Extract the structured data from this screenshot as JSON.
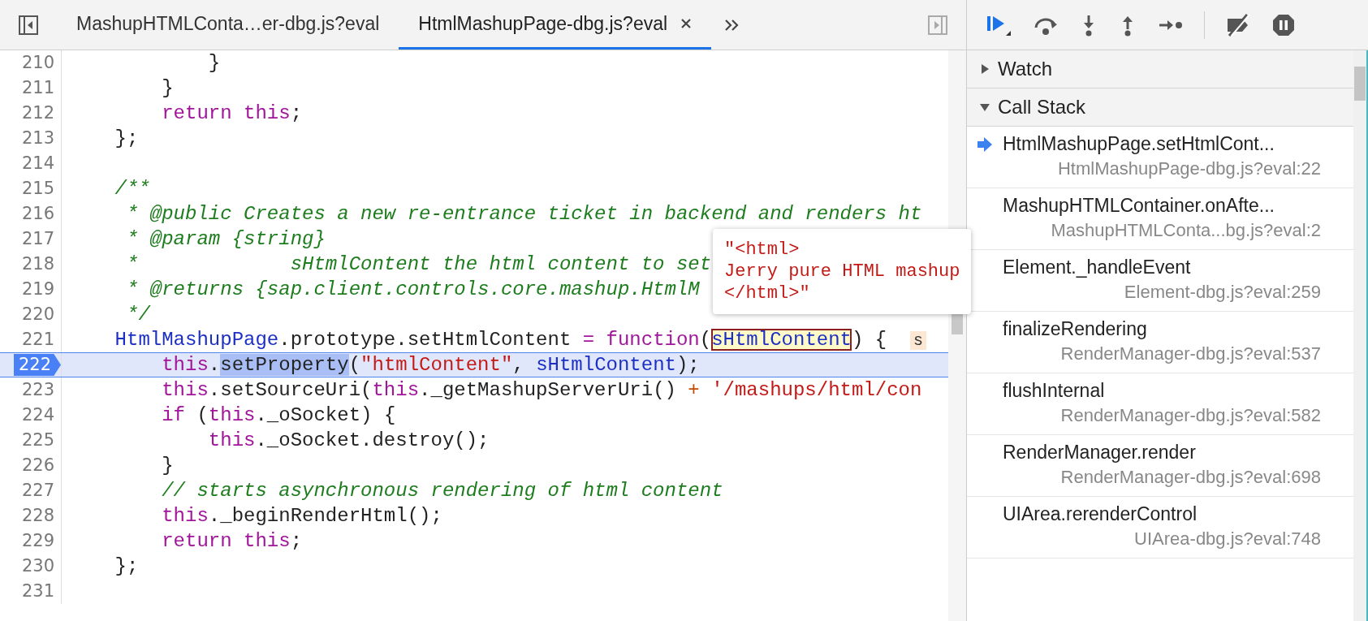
{
  "editor": {
    "tabs": [
      {
        "label": "MashupHTMLConta…er-dbg.js?eval",
        "selected": false,
        "closable": false
      },
      {
        "label": "HtmlMashupPage-dbg.js?eval",
        "selected": true,
        "closable": true
      }
    ],
    "lines": [
      {
        "number": "210",
        "paused": false,
        "tokens": [
          {
            "kind": "plain",
            "text": "            }"
          }
        ]
      },
      {
        "number": "211",
        "paused": false,
        "tokens": [
          {
            "kind": "plain",
            "text": "        }"
          }
        ]
      },
      {
        "number": "212",
        "paused": false,
        "tokens": [
          {
            "kind": "keyword",
            "text": "        return this"
          },
          {
            "kind": "plain",
            "text": ";"
          }
        ]
      },
      {
        "number": "213",
        "paused": false,
        "tokens": [
          {
            "kind": "plain",
            "text": "    };"
          }
        ]
      },
      {
        "number": "214",
        "paused": false
      },
      {
        "number": "215",
        "paused": false,
        "tokens": [
          {
            "kind": "comment",
            "text": "    /**"
          }
        ]
      },
      {
        "number": "216",
        "paused": false,
        "tokens": [
          {
            "kind": "comment",
            "text": "     * @public Creates a new re-entrance ticket in backend and renders ht"
          }
        ]
      },
      {
        "number": "217",
        "paused": false,
        "tokens": [
          {
            "kind": "comment",
            "text": "     * @param {string}"
          }
        ]
      },
      {
        "number": "218",
        "paused": false,
        "tokens": [
          {
            "kind": "comment",
            "text": "     *             sHtmlContent the html content to set"
          }
        ]
      },
      {
        "number": "219",
        "paused": false,
        "tokens": [
          {
            "kind": "comment",
            "text": "     * @returns {sap.client.controls.core.mashup.HtmlM"
          }
        ]
      },
      {
        "number": "220",
        "paused": false,
        "tokens": [
          {
            "kind": "comment",
            "text": "     */"
          }
        ]
      },
      {
        "number": "221",
        "paused": false,
        "tokens": [
          {
            "kind": "definition",
            "text": "    HtmlMashupPage"
          },
          {
            "kind": "plain",
            "text": ".prototype.setHtmlContent "
          },
          {
            "kind": "keyword",
            "text": "= function"
          },
          {
            "kind": "plain",
            "text": "("
          },
          {
            "kind": "hovered",
            "text": "sHtmlContent"
          },
          {
            "kind": "plain",
            "text": ") {  "
          },
          {
            "kind": "preview",
            "text": "s"
          }
        ]
      },
      {
        "number": "222",
        "paused": true,
        "tokens": [
          {
            "kind": "keyword",
            "text": "        this"
          },
          {
            "kind": "plain",
            "text": "."
          },
          {
            "kind": "current",
            "text": "setProperty"
          },
          {
            "kind": "plain",
            "text": "("
          },
          {
            "kind": "string",
            "text": "\"htmlContent\""
          },
          {
            "kind": "plain",
            "text": ", "
          },
          {
            "kind": "definition",
            "text": "sHtmlContent"
          },
          {
            "kind": "plain",
            "text": ");"
          }
        ]
      },
      {
        "number": "223",
        "paused": false,
        "tokens": [
          {
            "kind": "keyword",
            "text": "        this"
          },
          {
            "kind": "plain",
            "text": ".setSourceUri("
          },
          {
            "kind": "keyword",
            "text": "this"
          },
          {
            "kind": "plain",
            "text": "._getMashupServerUri() "
          },
          {
            "kind": "operator",
            "text": "+"
          },
          {
            "kind": "string",
            "text": " '/mashups/html/con"
          }
        ]
      },
      {
        "number": "224",
        "paused": false,
        "tokens": [
          {
            "kind": "keyword",
            "text": "        if"
          },
          {
            "kind": "plain",
            "text": " ("
          },
          {
            "kind": "keyword",
            "text": "this"
          },
          {
            "kind": "plain",
            "text": "._oSocket) {"
          }
        ]
      },
      {
        "number": "225",
        "paused": false,
        "tokens": [
          {
            "kind": "keyword",
            "text": "            this"
          },
          {
            "kind": "plain",
            "text": "._oSocket.destroy();"
          }
        ]
      },
      {
        "number": "226",
        "paused": false,
        "tokens": [
          {
            "kind": "plain",
            "text": "        }"
          }
        ]
      },
      {
        "number": "227",
        "paused": false,
        "tokens": [
          {
            "kind": "comment",
            "text": "        // starts asynchronous rendering of html content"
          }
        ]
      },
      {
        "number": "228",
        "paused": false,
        "tokens": [
          {
            "kind": "keyword",
            "text": "        this"
          },
          {
            "kind": "plain",
            "text": "._beginRenderHtml();"
          }
        ]
      },
      {
        "number": "229",
        "paused": false,
        "tokens": [
          {
            "kind": "keyword",
            "text": "        return this"
          },
          {
            "kind": "plain",
            "text": ";"
          }
        ]
      },
      {
        "number": "230",
        "paused": false,
        "tokens": [
          {
            "kind": "plain",
            "text": "    };"
          }
        ]
      },
      {
        "number": "231",
        "paused": false
      }
    ],
    "tooltip": {
      "lines": [
        "\"<html>",
        "Jerry pure HTML mashup",
        "</html>\""
      ]
    }
  },
  "debugger": {
    "sections": [
      {
        "title": "Watch",
        "expanded": false
      },
      {
        "title": "Call Stack",
        "expanded": true
      }
    ],
    "call_stack": [
      {
        "name": "HtmlMashupPage.setHtmlCont...",
        "location": "HtmlMashupPage-dbg.js?eval:22",
        "selected": true
      },
      {
        "name": "MashupHTMLContainer.onAfte...",
        "location": "MashupHTMLConta...bg.js?eval:2",
        "selected": false
      },
      {
        "name": "Element._handleEvent",
        "location": "Element-dbg.js?eval:259",
        "selected": false
      },
      {
        "name": "finalizeRendering",
        "location": "RenderManager-dbg.js?eval:537",
        "selected": false
      },
      {
        "name": "flushInternal",
        "location": "RenderManager-dbg.js?eval:582",
        "selected": false
      },
      {
        "name": "RenderManager.render",
        "location": "RenderManager-dbg.js?eval:698",
        "selected": false
      },
      {
        "name": "UIArea.rerenderControl",
        "location": "UIArea-dbg.js?eval:748",
        "selected": false
      }
    ]
  }
}
